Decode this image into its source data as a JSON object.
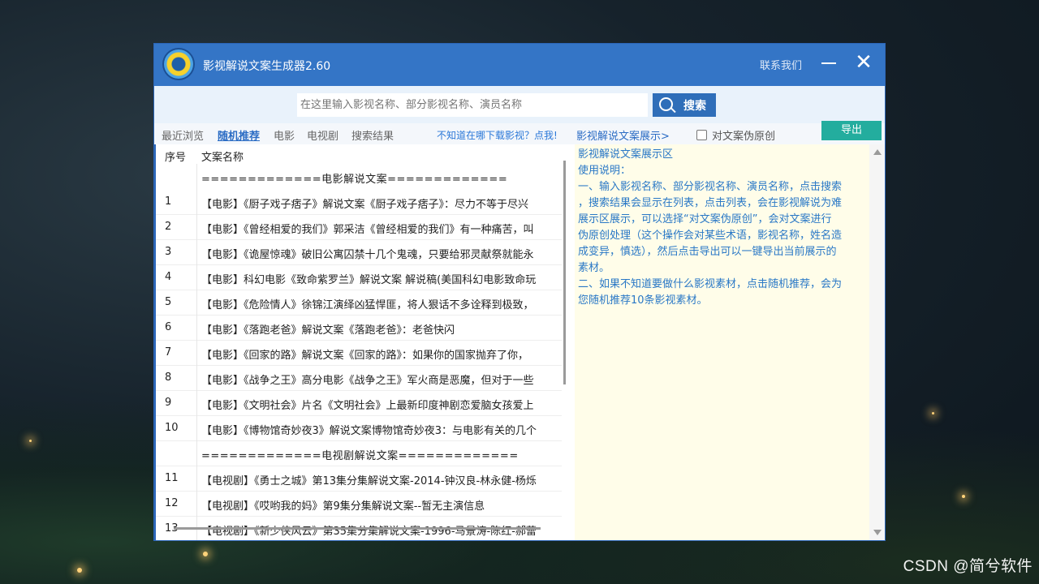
{
  "app": {
    "title": "影视解说文案生成器2.60",
    "contact": "联系我们",
    "close_glyph": "✕"
  },
  "search": {
    "placeholder": "在这里输入影视名称、部分影视名称、演员名称",
    "button_label": "搜索"
  },
  "tabs": [
    {
      "label": "最近浏览",
      "active": false
    },
    {
      "label": "随机推荐",
      "active": true
    },
    {
      "label": "电影",
      "active": false
    },
    {
      "label": "电视剧",
      "active": false
    },
    {
      "label": "搜索结果",
      "active": false
    }
  ],
  "hint_link": "不知道在哪下载影视？点我!",
  "display_link": "影视解说文案展示>",
  "original_checkbox": {
    "label": "对文案伪原创",
    "checked": false
  },
  "export_label": "导出",
  "list": {
    "headers": {
      "index": "序号",
      "name": "文案名称"
    },
    "rows": [
      {
        "index": "",
        "name": "=============电影解说文案=============",
        "section": true
      },
      {
        "index": "1",
        "name": "【电影】《厨子戏子痞子》解说文案《厨子戏子痞子》：尽力不等于尽兴"
      },
      {
        "index": "2",
        "name": "【电影】《曾经相爱的我们》郭采洁《曾经相爱的我们》有一种痛苦，叫"
      },
      {
        "index": "3",
        "name": "【电影】《诡屋惊魂》破旧公寓囚禁十几个鬼魂，只要给邪灵献祭就能永"
      },
      {
        "index": "4",
        "name": "【电影】科幻电影《致命紫罗兰》解说文案 解说稿(美国科幻电影致命玩"
      },
      {
        "index": "5",
        "name": "【电影】《危险情人》徐锦江演绎凶猛悍匪，将人狠话不多诠释到极致，"
      },
      {
        "index": "6",
        "name": "【电影】《落跑老爸》解说文案《落跑老爸》：老爸快闪"
      },
      {
        "index": "7",
        "name": "【电影】《回家的路》解说文案《回家的路》：如果你的国家抛弃了你，"
      },
      {
        "index": "8",
        "name": "【电影】《战争之王》高分电影《战争之王》军火商是恶魔，但对于一些"
      },
      {
        "index": "9",
        "name": "【电影】《文明社会》片名《文明社会》上最新印度神剧恋爱脑女孩爱上"
      },
      {
        "index": "10",
        "name": "【电影】《博物馆奇妙夜3》解说文案博物馆奇妙夜3：与电影有关的几个"
      },
      {
        "index": "",
        "name": "=============电视剧解说文案=============",
        "section": true
      },
      {
        "index": "11",
        "name": "【电视剧】《勇士之城》第13集分集解说文案-2014-钟汉良-林永健-杨烁"
      },
      {
        "index": "12",
        "name": "【电视剧】《哎哟我的妈》第9集分集解说文案--暂无主演信息"
      },
      {
        "index": "13",
        "name": "【电视剧】《新少侠风云》第35集分集解说文案-1996-马景涛-陈红-郝蕾"
      }
    ]
  },
  "panel": {
    "title": "影视解说文案展示区",
    "usage": "使用说明：",
    "lines": [
      "一、输入影视名称、部分影视名称、演员名称，点击搜索",
      "，搜索结果会显示在列表，点击列表，会在影视解说为难",
      "展示区展示，可以选择“对文案伪原创”，会对文案进行",
      "伪原创处理（这个操作会对某些术语，影视名称，姓名造",
      "成变异，慎选），然后点击导出可以一键导出当前展示的",
      "素材。",
      "二、如果不知道要做什么影视素材，点击随机推荐，会为",
      "您随机推荐10条影视素材。"
    ]
  },
  "watermark": "CSDN @简兮软件",
  "colors": {
    "titlebar": "#3475c6",
    "search_button": "#2f6eb9",
    "export_button": "#23ad9e",
    "link": "#2b6cc4",
    "panel_bg": "#fffde9",
    "panel_text": "#2a78c6"
  }
}
